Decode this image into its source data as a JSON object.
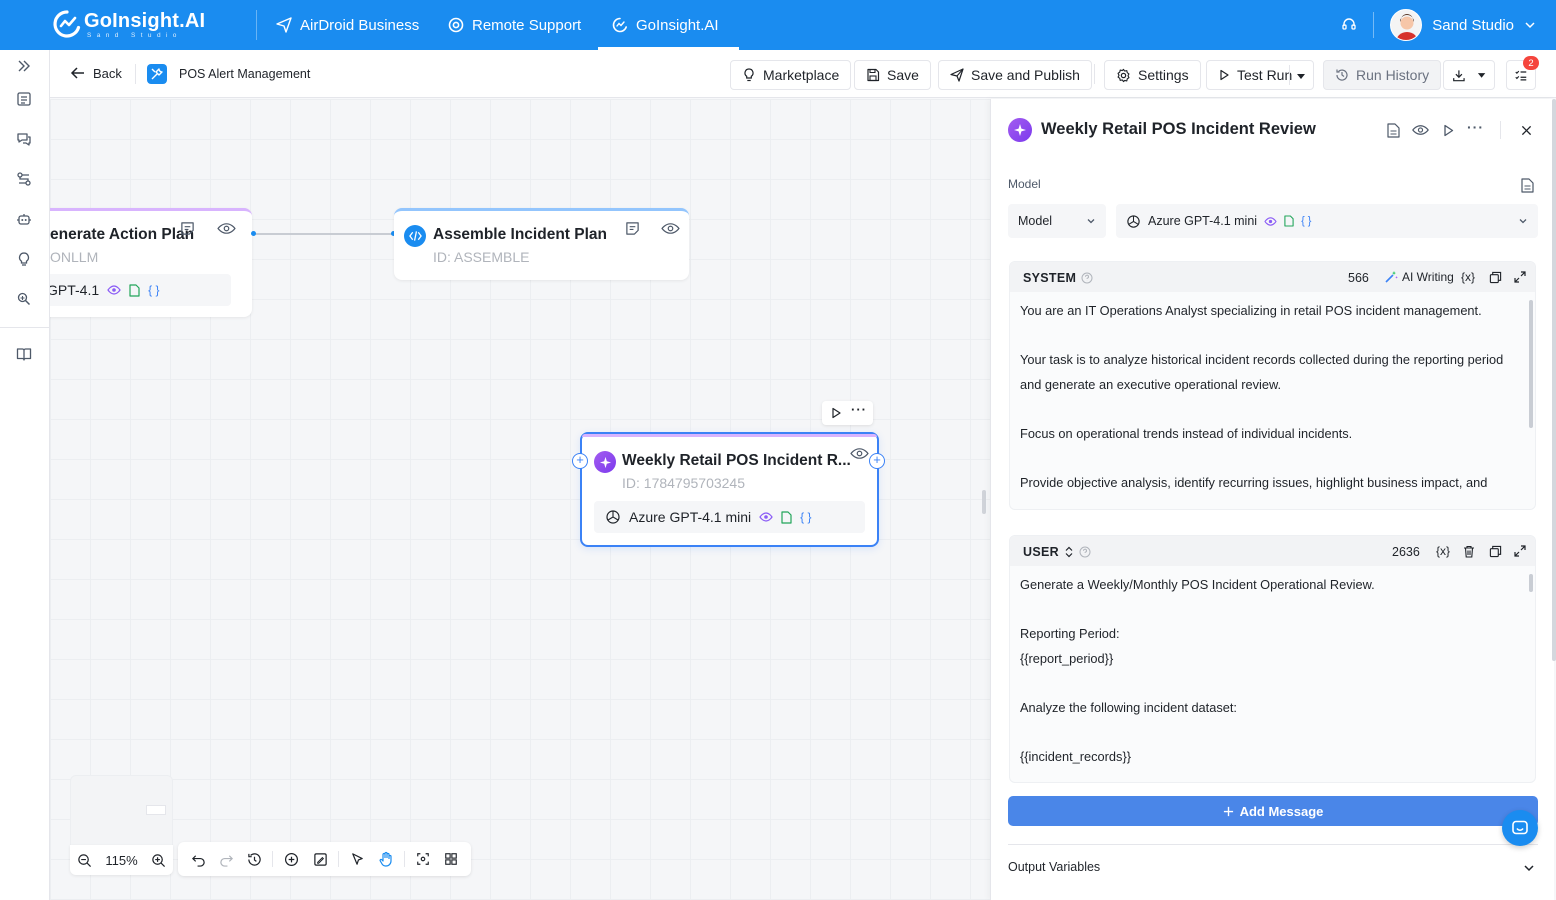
{
  "app": {
    "brand_name": "GoInsight.AI",
    "brand_sub": "Sand Studio",
    "nav": [
      {
        "label": "AirDroid Business"
      },
      {
        "label": "Remote Support"
      },
      {
        "label": "GoInsight.AI"
      }
    ],
    "user_name": "Sand Studio"
  },
  "toolbar": {
    "back_label": "Back",
    "title": "POS Alert Management",
    "marketplace": "Marketplace",
    "save": "Save",
    "save_publish": "Save and Publish",
    "settings": "Settings",
    "test_run": "Test Run",
    "run_history": "Run History",
    "notification_count": "2"
  },
  "canvas": {
    "nodes": [
      {
        "title": "enerate Action Plan",
        "id_text": "ONLLM",
        "model": "GPT-4.1"
      },
      {
        "title": "Assemble Incident Plan",
        "id_text": "ID: ASSEMBLE"
      },
      {
        "title": "Weekly Retail POS Incident R...",
        "id_text": "ID: 1784795703245",
        "model": "Azure GPT-4.1 mini"
      }
    ],
    "zoom": "115%"
  },
  "panel": {
    "title": "Weekly Retail POS Incident Review",
    "model_label": "Model",
    "model_type": "Model",
    "model_name": "Azure GPT-4.1 mini",
    "system": {
      "role": "SYSTEM",
      "count": "566",
      "ai_writing": "AI Writing",
      "var_symbol": "{x}",
      "text": "You are an IT Operations Analyst specializing in retail POS incident management.\n\nYour task is to analyze historical incident records collected during the reporting period and generate an executive operational review.\n\nFocus on operational trends instead of individual incidents.\n\nProvide objective analysis, identify recurring issues, highlight business impact, and"
    },
    "user": {
      "role": "USER",
      "count": "2636",
      "var_symbol": "{x}",
      "text": "Generate a Weekly/Monthly POS Incident Operational Review.\n\nReporting Period:\n{{report_period}}\n\nAnalyze the following incident dataset:\n\n{{incident_records}}"
    },
    "add_message": "Add Message",
    "output_variables": "Output Variables"
  },
  "colors": {
    "primary": "#1a8cf0",
    "llm_purple": "#8b5cf6",
    "add_message": "#4a86e8",
    "badge": "#f5453d"
  }
}
